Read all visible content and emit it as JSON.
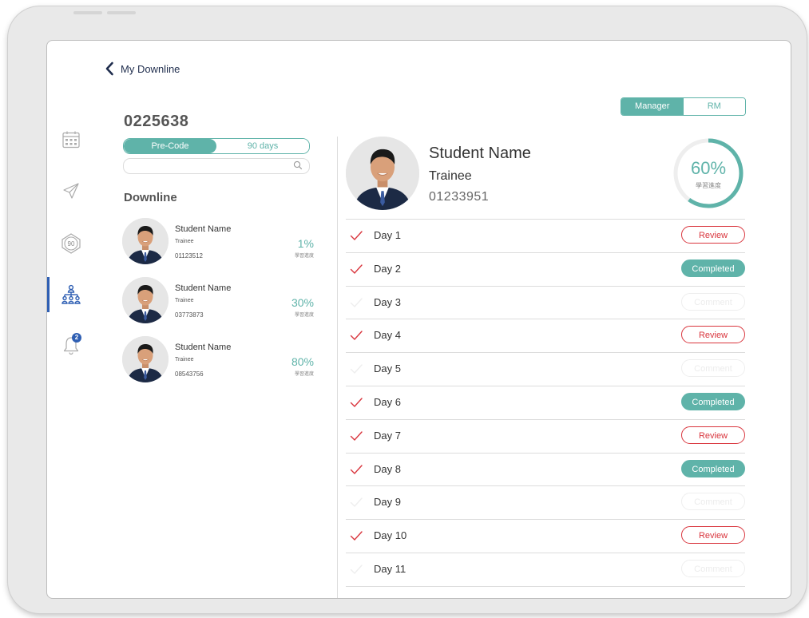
{
  "header": {
    "back_label": "My Downline"
  },
  "role_toggle": {
    "manager": "Manager",
    "rm": "RM",
    "selected": "Manager"
  },
  "sidebar": {
    "items": [
      {
        "name": "calendar-icon"
      },
      {
        "name": "send-icon"
      },
      {
        "name": "badge-90-icon",
        "label": "90"
      },
      {
        "name": "hierarchy-icon",
        "active": true
      },
      {
        "name": "bell-icon",
        "badge": "2"
      }
    ]
  },
  "left": {
    "agent_code": "0225638",
    "period_toggle": {
      "pre_code": "Pre-Code",
      "ninety_days": "90 days",
      "selected": "Pre-Code"
    },
    "search": {
      "placeholder": ""
    },
    "section_title": "Downline",
    "downline": [
      {
        "name": "Student Name",
        "role": "Trainee",
        "id": "01123512",
        "pct": "1%",
        "pct_label": "學習進度"
      },
      {
        "name": "Student Name",
        "role": "Trainee",
        "id": "03773873",
        "pct": "30%",
        "pct_label": "學習進度"
      },
      {
        "name": "Student Name",
        "role": "Trainee",
        "id": "08543756",
        "pct": "80%",
        "pct_label": "學習進度"
      }
    ]
  },
  "profile": {
    "name": "Student Name",
    "role": "Trainee",
    "id": "01233951",
    "progress": 60,
    "progress_text": "60%",
    "progress_label": "學習進度"
  },
  "colors": {
    "accent": "#5fb3a9",
    "review": "#d9353d",
    "nav_active": "#2f5fb3"
  },
  "days": [
    {
      "label": "Day 1",
      "checked": true,
      "status": "review",
      "status_label": "Review"
    },
    {
      "label": "Day 2",
      "checked": true,
      "status": "completed",
      "status_label": "Completed"
    },
    {
      "label": "Day 3",
      "checked": false,
      "status": "disabled",
      "status_label": "Comment"
    },
    {
      "label": "Day 4",
      "checked": true,
      "status": "review",
      "status_label": "Review"
    },
    {
      "label": "Day 5",
      "checked": false,
      "status": "disabled",
      "status_label": "Comment"
    },
    {
      "label": "Day 6",
      "checked": true,
      "status": "completed",
      "status_label": "Completed"
    },
    {
      "label": "Day 7",
      "checked": true,
      "status": "review",
      "status_label": "Review"
    },
    {
      "label": "Day 8",
      "checked": true,
      "status": "completed",
      "status_label": "Completed"
    },
    {
      "label": "Day 9",
      "checked": false,
      "status": "disabled",
      "status_label": "Comment"
    },
    {
      "label": "Day 10",
      "checked": true,
      "status": "review",
      "status_label": "Review"
    },
    {
      "label": "Day 11",
      "checked": false,
      "status": "disabled",
      "status_label": "Comment"
    }
  ]
}
